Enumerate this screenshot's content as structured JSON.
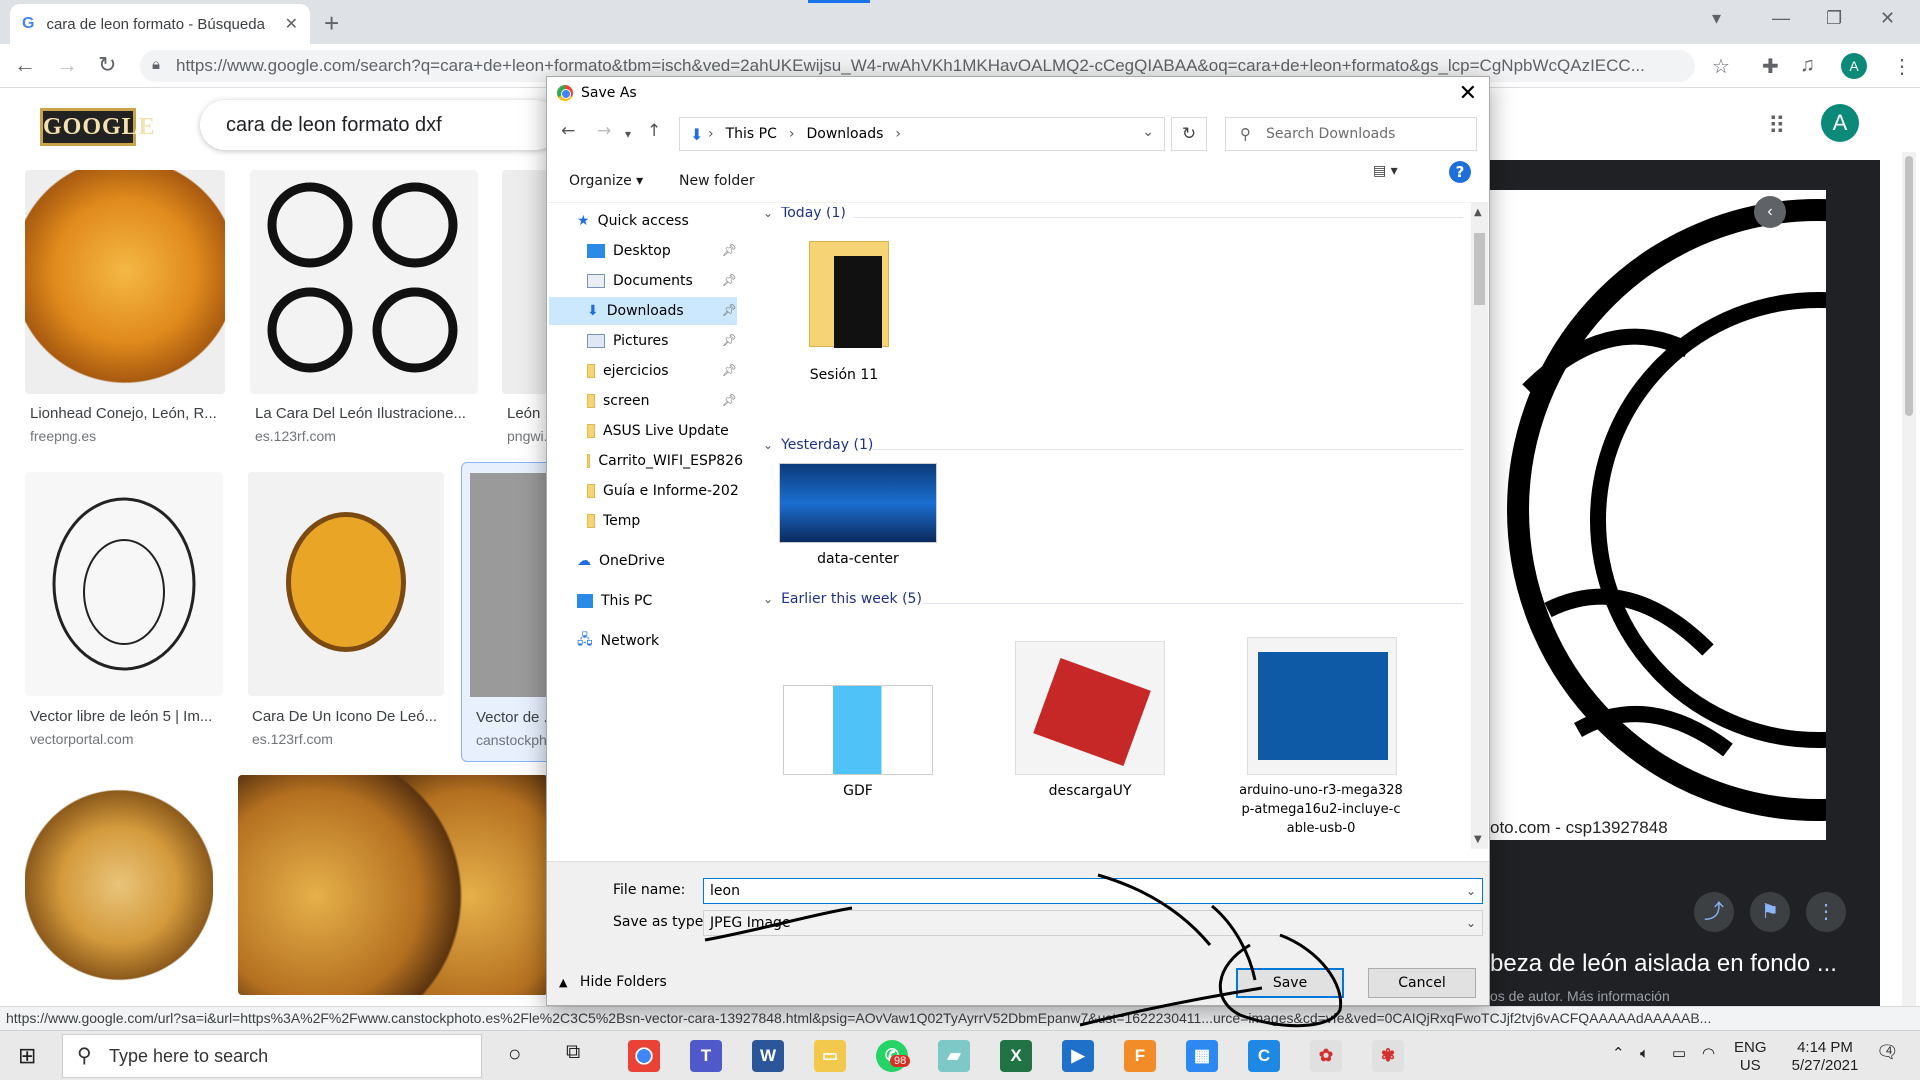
{
  "browser": {
    "tab_title": "cara de leon formato - Búsqueda",
    "tab_close": "✕",
    "new_tab": "+",
    "url": "https://www.google.com/search?q=cara+de+leon+formato&tbm=isch&ved=2ahUKEwijsu_W4-rwAhVKh1MKHavOALMQ2-cCegQIABAA&oq=cara+de+leon+formato&gs_lcp=CgNpbWcQAzIECC...",
    "avatar_letter": "A",
    "status_url": "https://www.google.com/url?sa=i&url=https%3A%2F%2Fwww.canstockphoto.es%2Fle%2C3C5%2Bsn-vector-cara-13927848.html&psig=AOvVaw1Q02TyAyrrV52DbmEpanw7&ust=1622230411...urce=images&cd=vfe&ved=0CAIQjRxqFwoTCJjf2tvj6vACFQAAAAAdAAAAAB..."
  },
  "google": {
    "logo": "GOOGLE",
    "query": "cara de leon formato dxf",
    "results": [
      {
        "caption": "Lionhead Conejo, León, R...",
        "source": "freepng.es"
      },
      {
        "caption": "La Cara Del León Ilustracione...",
        "source": "es.123rf.com"
      },
      {
        "caption": "León ...",
        "source": "pngwi..."
      },
      {
        "caption": "Vector libre de león 5 | Im...",
        "source": "vectorportal.com"
      },
      {
        "caption": "Cara De Un Icono De Leó...",
        "source": "es.123rf.com"
      },
      {
        "caption": "Vector de ...",
        "source": "canstockph..."
      }
    ],
    "preview": {
      "credit": "oto.com - csp13927848",
      "caption": "beza de león aislada en fondo ...",
      "source": "os de autor. Más información"
    }
  },
  "dialog": {
    "title": "Save As",
    "breadcrumb": [
      "This PC",
      "Downloads"
    ],
    "search_placeholder": "Search Downloads",
    "organize": "Organize ▾",
    "new_folder": "New folder",
    "help": "?",
    "nav_items": [
      {
        "label": "Quick access"
      },
      {
        "label": "Desktop"
      },
      {
        "label": "Documents"
      },
      {
        "label": "Downloads"
      },
      {
        "label": "Pictures"
      },
      {
        "label": "ejercicios"
      },
      {
        "label": "screen"
      },
      {
        "label": "ASUS Live Update"
      },
      {
        "label": "Carrito_WIFI_ESP826"
      },
      {
        "label": "Guía e Informe-202"
      },
      {
        "label": "Temp"
      },
      {
        "label": "OneDrive"
      },
      {
        "label": "This PC"
      },
      {
        "label": "Network"
      }
    ],
    "groups": [
      {
        "label": "Today (1)"
      },
      {
        "label": "Yesterday (1)"
      },
      {
        "label": "Earlier this week (5)"
      }
    ],
    "files": [
      {
        "name": "Sesión 11"
      },
      {
        "name": "data-center"
      },
      {
        "name": "GDF"
      },
      {
        "name": "descargaUY"
      },
      {
        "name": "arduino-uno-r3-mega328 p-atmega16u2-incluye-c able-usb-0"
      }
    ],
    "file_name_label": "File name:",
    "file_name_value": "leon",
    "save_type_label": "Save as type:",
    "save_type_value": "JPEG Image",
    "hide_folders": "Hide Folders",
    "save": "Save",
    "cancel": "Cancel"
  },
  "taskbar": {
    "search_placeholder": "Type here to search",
    "badge_count": "98",
    "lang": "ENG",
    "region": "US",
    "time": "4:14 PM",
    "date": "5/27/2021",
    "notifications": "4"
  }
}
